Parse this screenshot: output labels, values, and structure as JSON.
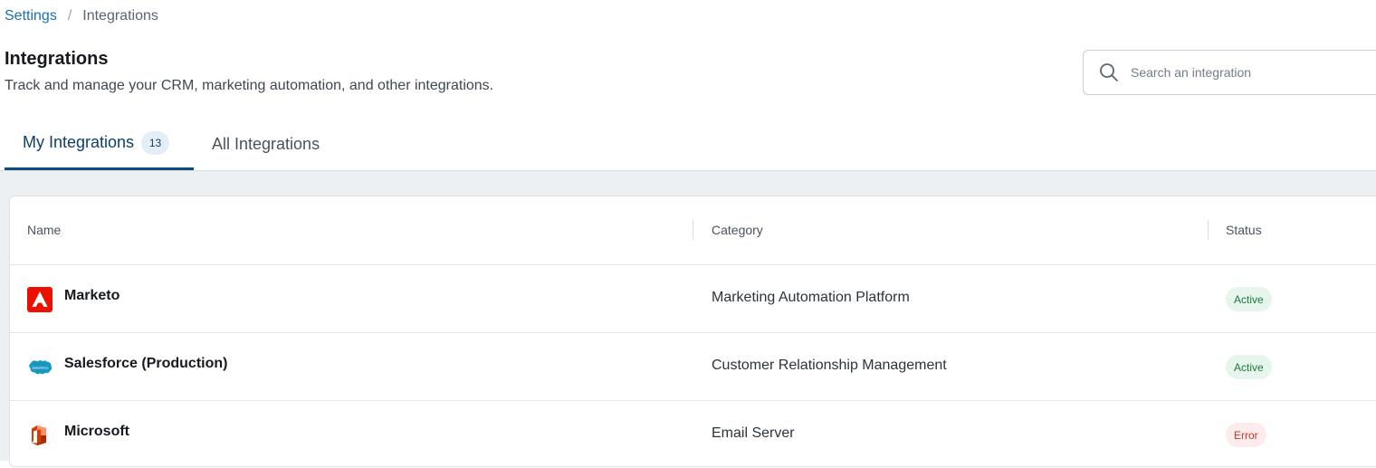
{
  "breadcrumb": {
    "parent": "Settings",
    "separator": "/",
    "current": "Integrations"
  },
  "header": {
    "title": "Integrations",
    "subtitle": "Track and manage your CRM, marketing automation, and other integrations."
  },
  "search": {
    "placeholder": "Search an integration",
    "value": "",
    "icon": "search-icon"
  },
  "tabs": [
    {
      "label": "My Integrations",
      "count": "13",
      "active": true
    },
    {
      "label": "All Integrations",
      "active": false
    }
  ],
  "table": {
    "columns": [
      "Name",
      "Category",
      "Status"
    ],
    "rows": [
      {
        "name": "Marketo",
        "icon": "marketo-logo-icon",
        "category": "Marketing Automation Platform",
        "status": "Active"
      },
      {
        "name": "Salesforce (Production)",
        "icon": "salesforce-logo-icon",
        "category": "Customer Relationship Management",
        "status": "Active"
      },
      {
        "name": "Microsoft",
        "icon": "microsoft-office-logo-icon",
        "category": "Email Server",
        "status": "Error"
      }
    ]
  },
  "colors": {
    "link": "#1a6fb3",
    "active_tab": "#0d4b7e",
    "status_active_bg": "#e7f6ec",
    "status_active_text": "#1b7a3a",
    "status_error_bg": "#fdecec",
    "status_error_text": "#c0392b"
  }
}
